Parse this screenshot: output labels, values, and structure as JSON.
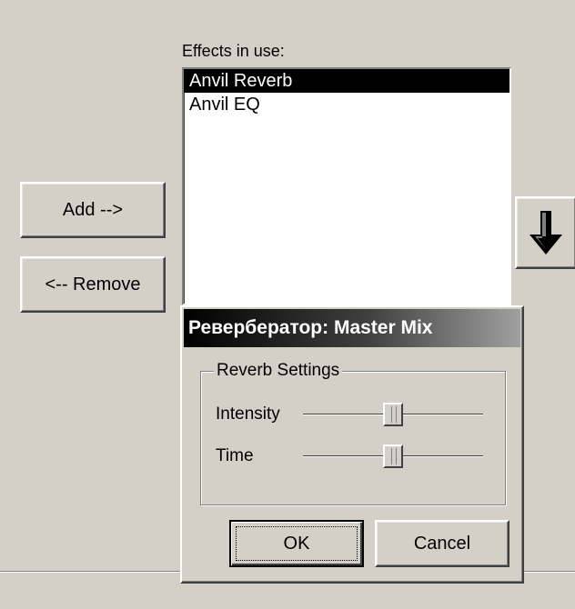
{
  "effects_label": "Effects in use:",
  "effects_list": [
    {
      "label": "Anvil Reverb",
      "selected": true
    },
    {
      "label": "Anvil EQ",
      "selected": false
    }
  ],
  "add_button": "Add -->",
  "remove_button": "<-- Remove",
  "move_down_icon": "arrow-down-icon",
  "dialog": {
    "title": "Ревербератор: Master Mix",
    "group_title": "Reverb Settings",
    "sliders": [
      {
        "label": "Intensity",
        "value": 0.5
      },
      {
        "label": "Time",
        "value": 0.5
      }
    ],
    "ok_button": "OK",
    "cancel_button": "Cancel"
  }
}
